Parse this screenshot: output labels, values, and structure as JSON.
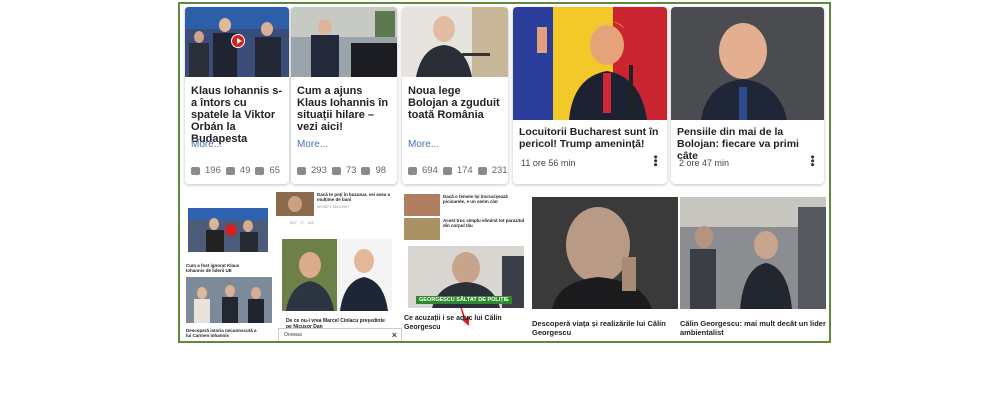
{
  "top_cards": [
    {
      "title": "Klaus Iohannis s-a întors cu spatele la Viktor Orbán la Budapesta",
      "more": "More...",
      "likes": "196",
      "comments": "49",
      "shares": "65",
      "video": true
    },
    {
      "title": "Cum a ajuns Klaus Iohannis în situații hilare – vezi aici!",
      "more": "More...",
      "likes": "293",
      "comments": "73",
      "shares": "98",
      "video": false
    },
    {
      "title": "Noua lege Bolojan a zguduit toată România",
      "more": "More...",
      "likes": "694",
      "comments": "174",
      "shares": "231",
      "video": false
    },
    {
      "title": "Locuitorii Bucharest sunt în pericol! Trump amenință!",
      "time": "11 ore 56 min"
    },
    {
      "title": "Pensiile din mai de la Bolojan: fiecare va primi câte",
      "time": "2 ore 47 min"
    }
  ],
  "bottom": {
    "col1": {
      "caption1": "Cum a fost ignorat Klaus Iohannis de liderii UE",
      "caption2": "Descoperă istoria necunoscută a lui Carmen Iohannis"
    },
    "col2": {
      "ad_line": "Dacă te poți în buzunar, vei avea o mulțime de bani",
      "ad_source": "MONEY MAGNET",
      "ad_likes": "597",
      "ad_comments": "77",
      "ad_shares": "162",
      "caption": "De ce nu-l vrea Marcel Ciolacu președinte pe Nicușor Dan",
      "popup_text": "Ономаз"
    },
    "col3": {
      "ad1": "Dacă o femeie își încrucișează picioarele, e un semn clar",
      "ad2": "Acest truc simplu elimină tot parazitul din corpul tău",
      "banner": "GEORGESCU SĂLTAT DE POLIȚIE",
      "caption": "Ce acuzații i se aduc lui Călin Georgescu"
    },
    "col4": {
      "caption": "Descoperă viața și realizările lui Călin Georgescu"
    },
    "col5": {
      "caption": "Călin Georgescu: mai mult decât un lider ambientalist"
    }
  },
  "colors": {
    "frame": "#5f8a3c",
    "more_link": "#4a6fb5",
    "play": "#d32020"
  }
}
